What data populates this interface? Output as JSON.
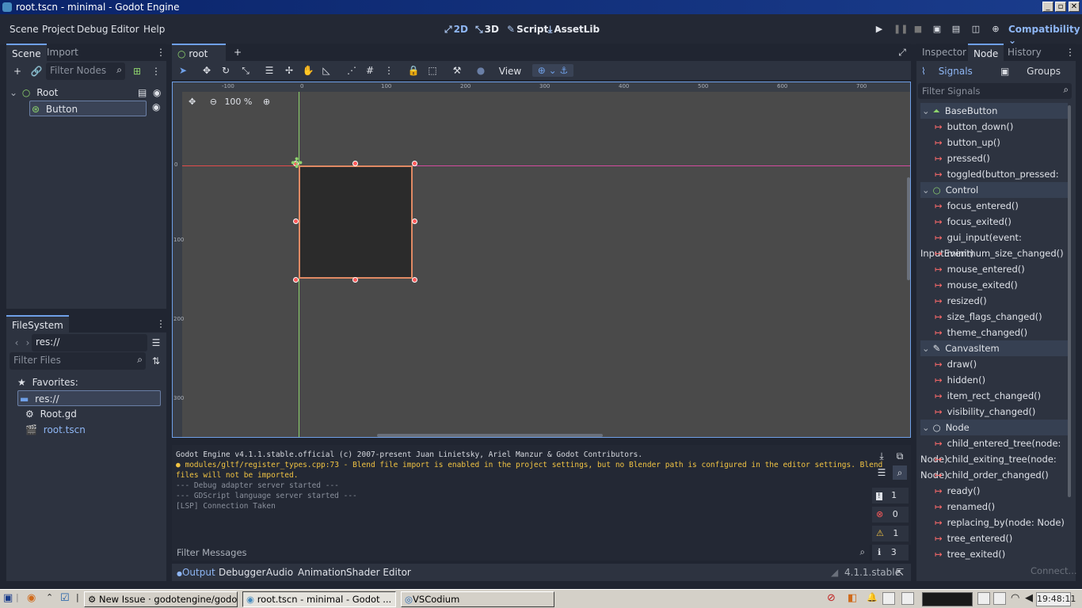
{
  "window": {
    "title": "root.tscn - minimal - Godot Engine"
  },
  "menu": {
    "items": [
      "Scene",
      "Project",
      "Debug",
      "Editor",
      "Help"
    ]
  },
  "workspaces": {
    "w2d": "2D",
    "w3d": "3D",
    "script": "Script",
    "assetlib": "AssetLib"
  },
  "renderer": "Compatibility",
  "scene_dock": {
    "tabs": [
      "Scene",
      "Import"
    ],
    "filter_placeholder": "Filter Nodes",
    "nodes": [
      "Root",
      "Button"
    ]
  },
  "filesystem_dock": {
    "tab": "FileSystem",
    "path": "res://",
    "filter_placeholder": "Filter Files",
    "favorites": "Favorites:",
    "items": [
      "res://",
      "Root.gd",
      "root.tscn"
    ]
  },
  "editor_tabs": {
    "scene_tab": "root"
  },
  "viewport": {
    "zoom": "100 %",
    "view_label": "View",
    "ruler_top": [
      "-100",
      "0",
      "100",
      "200",
      "300",
      "400",
      "500",
      "600",
      "700"
    ],
    "ruler_left": [
      "0",
      "100",
      "200",
      "300"
    ]
  },
  "output": {
    "lines": [
      "Godot Engine v4.1.1.stable.official (c) 2007-present Juan Linietsky, Ariel Manzur & Godot Contributors.",
      "modules/gltf/register_types.cpp:73 - Blend file import is enabled in the project settings, but no Blender path is configured in the editor settings. Blend",
      "files will not be imported.",
      "--- Debug adapter server started ---",
      "--- GDScript language server started ---",
      "[LSP] Connection Taken"
    ],
    "filter_placeholder": "Filter Messages",
    "counts": {
      "errors_msgs": "1",
      "errors": "0",
      "warnings": "1",
      "info": "3"
    }
  },
  "bottom_tabs": [
    "Output",
    "Debugger",
    "Audio",
    "Animation",
    "Shader Editor"
  ],
  "version": "4.1.1.stable",
  "inspector": {
    "tabs": [
      "Inspector",
      "Node",
      "History"
    ],
    "subtabs": {
      "signals": "Signals",
      "groups": "Groups"
    },
    "filter_placeholder": "Filter Signals",
    "connect_label": "Connect...",
    "categories": [
      {
        "name": "BaseButton",
        "signals": [
          "button_down()",
          "button_up()",
          "pressed()",
          "toggled(button_pressed: bool)"
        ]
      },
      {
        "name": "Control",
        "signals": [
          "focus_entered()",
          "focus_exited()",
          "gui_input(event: InputEvent)",
          "minimum_size_changed()",
          "mouse_entered()",
          "mouse_exited()",
          "resized()",
          "size_flags_changed()",
          "theme_changed()"
        ]
      },
      {
        "name": "CanvasItem",
        "signals": [
          "draw()",
          "hidden()",
          "item_rect_changed()",
          "visibility_changed()"
        ]
      },
      {
        "name": "Node",
        "signals": [
          "child_entered_tree(node: Node)",
          "child_exiting_tree(node: Node)",
          "child_order_changed()",
          "ready()",
          "renamed()",
          "replacing_by(node: Node)",
          "tree_entered()",
          "tree_exited()"
        ]
      }
    ]
  },
  "taskbar": {
    "tasks": [
      "New Issue · godotengine/godot ...",
      "root.tscn - minimal - Godot ...",
      "VSCodium"
    ],
    "clock": "19:48:11"
  }
}
